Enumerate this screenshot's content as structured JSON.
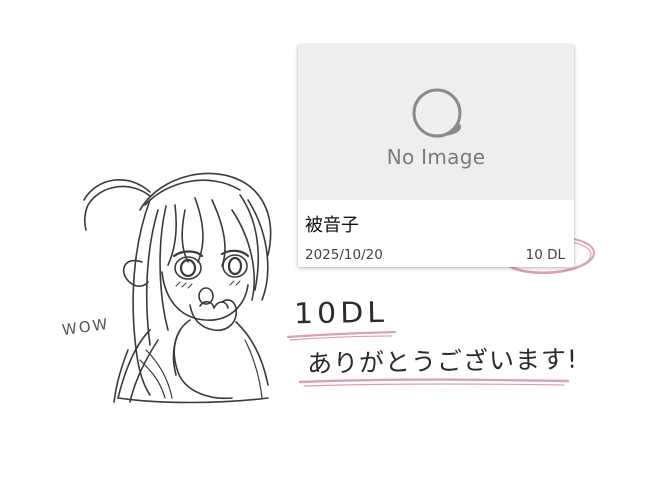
{
  "card": {
    "placeholder_text": "No Image",
    "title": "被音子",
    "date": "2025/10/20",
    "downloads": "10 DL"
  },
  "sketch": {
    "wow_text": "WOW",
    "count_text": "10DL",
    "thanks_text": "ありがとうございます!"
  },
  "colors": {
    "card_background": "#ffffff",
    "thumbnail_background": "#eeeeee",
    "placeholder_text": "#7b7b7b",
    "highlight_pink": "#d9a3ac",
    "sketch_gray": "#3a3a3a"
  },
  "icons": {
    "placeholder": "no-image-circle-icon"
  }
}
